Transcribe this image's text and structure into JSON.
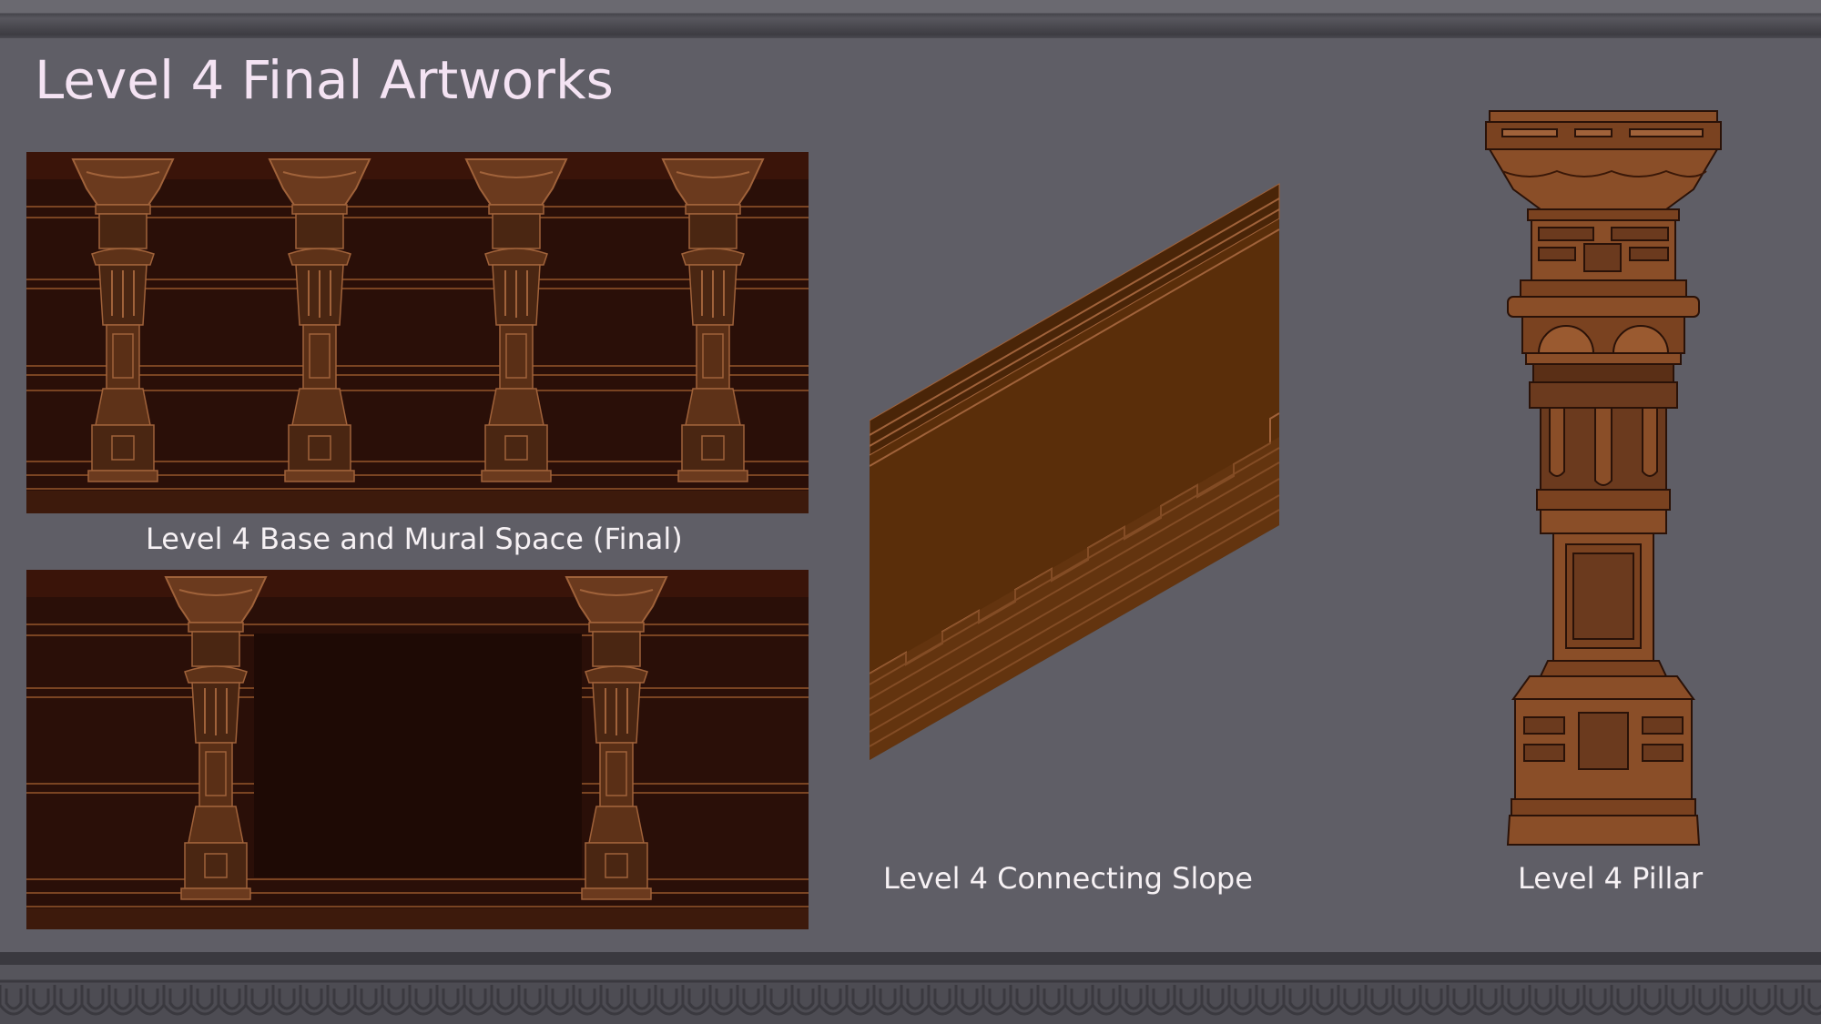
{
  "slide": {
    "title": "Level 4 Final Artworks"
  },
  "captions": {
    "base": "Level 4 Base and Mural Space (Final)",
    "slope": "Level 4 Connecting Slope",
    "pillar": "Level 4 Pillar"
  },
  "colors": {
    "background": "#5f5e66",
    "title": "#f4e3f3",
    "artwork_dark": "#2a0f08",
    "artwork_wood": "#6b3a1e",
    "artwork_light": "#a0623a",
    "slope_fill": "#5a2e0a"
  }
}
